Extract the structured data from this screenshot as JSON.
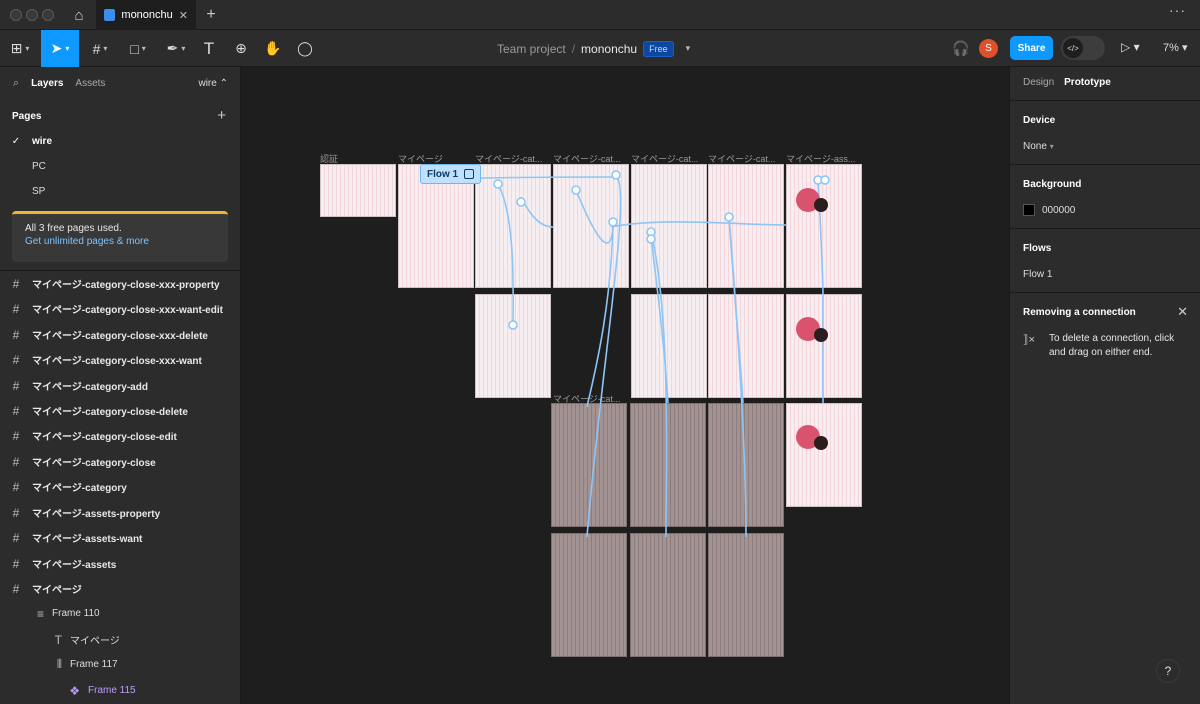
{
  "window": {
    "file_tab": "mononchu"
  },
  "toolbar": {
    "breadcrumb_project": "Team project",
    "breadcrumb_sep": "/",
    "file_name": "mononchu",
    "plan_badge": "Free",
    "avatar_initial": "S",
    "share_label": "Share",
    "zoom": "7%"
  },
  "left_panel": {
    "tab_layers": "Layers",
    "tab_assets": "Assets",
    "current_page": "wire",
    "pages_header": "Pages",
    "pages": [
      {
        "label": "wire",
        "selected": true
      },
      {
        "label": "PC",
        "selected": false
      },
      {
        "label": "SP",
        "selected": false
      }
    ],
    "upsell_text": "All 3 free pages used.",
    "upsell_link": "Get unlimited pages & more",
    "layers": [
      {
        "label": "マイページ-category-close-xxx-property",
        "icon": "frame-icon"
      },
      {
        "label": "マイページ-category-close-xxx-want-edit",
        "icon": "frame-icon"
      },
      {
        "label": "マイページ-category-close-xxx-delete",
        "icon": "frame-icon"
      },
      {
        "label": "マイページ-category-close-xxx-want",
        "icon": "frame-icon"
      },
      {
        "label": "マイページ-category-add",
        "icon": "frame-icon"
      },
      {
        "label": "マイページ-category-close-delete",
        "icon": "frame-icon"
      },
      {
        "label": "マイページ-category-close-edit",
        "icon": "frame-icon"
      },
      {
        "label": "マイページ-category-close",
        "icon": "frame-icon"
      },
      {
        "label": "マイページ-category",
        "icon": "frame-icon"
      },
      {
        "label": "マイページ-assets-property",
        "icon": "frame-icon"
      },
      {
        "label": "マイページ-assets-want",
        "icon": "frame-icon"
      },
      {
        "label": "マイページ-assets",
        "icon": "frame-icon"
      },
      {
        "label": "マイページ",
        "icon": "frame-icon"
      },
      {
        "label": "Frame 110",
        "icon": "auto-layout-icon"
      },
      {
        "label": "マイページ",
        "icon": "text-icon"
      },
      {
        "label": "Frame 117",
        "icon": "auto-layout-icon"
      },
      {
        "label": "Frame 115",
        "icon": "component-icon"
      }
    ]
  },
  "canvas": {
    "flow_chip": "Flow 1",
    "frame_labels": [
      "認証",
      "マイページ",
      "マイページ-cat...",
      "マイページ-cat...",
      "マイページ-cat...",
      "マイページ-cat...",
      "マイページ-ass...",
      "マイページ-cat..."
    ]
  },
  "right_panel": {
    "tab_design": "Design",
    "tab_prototype": "Prototype",
    "device_header": "Device",
    "device_value": "None",
    "background_header": "Background",
    "background_value": "000000",
    "background_color": "#000000",
    "flows_header": "Flows",
    "flow_item": "Flow 1",
    "removing_header": "Removing a connection",
    "removing_desc": "To delete a connection, click and drag on either end."
  },
  "help_label": "?",
  "colors": {
    "accent": "#0d99ff",
    "upsell_bar": "#f3b431",
    "avatar": "#e0502b",
    "flow_connector": "#8ec5f5"
  }
}
